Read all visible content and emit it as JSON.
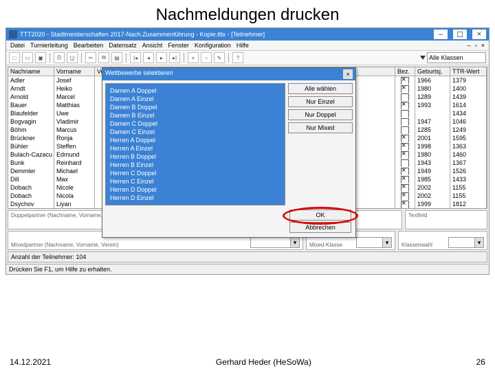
{
  "slide": {
    "title": "Nachmeldungen drucken",
    "date": "14.12.2021",
    "author": "Gerhard Heder (HeSoWa)",
    "page": "26"
  },
  "window": {
    "title": "TTT2020 - Stadtmeisterschaften 2017-Nach.Zusammenführung - Kopie.tttx - [Teilnehmer]"
  },
  "menu": {
    "m0": "Datei",
    "m1": "Turnierleitung",
    "m2": "Bearbeiten",
    "m3": "Datensatz",
    "m4": "Ansicht",
    "m5": "Fenster",
    "m6": "Konfiguration",
    "m7": "Hilfe"
  },
  "toolbar": {
    "klassen": "Alle Klassen"
  },
  "columns": {
    "c1": "Nachname",
    "c2": "Vorname",
    "c3": "Verein",
    "c4": "Bez.",
    "c5": "Geburtsj.",
    "c6": "TTR-Wert"
  },
  "rows": [
    {
      "n": "Adler",
      "v": "Josef",
      "b": true,
      "g": "1966",
      "t": "1379"
    },
    {
      "n": "Arndt",
      "v": "Heiko",
      "b": true,
      "g": "1980",
      "t": "1400"
    },
    {
      "n": "Arnold",
      "v": "Marcel",
      "b": false,
      "g": "1289",
      "t": "1439"
    },
    {
      "n": "Bauer",
      "v": "Matthias",
      "b": true,
      "g": "1993",
      "t": "1614"
    },
    {
      "n": "Blaufelder",
      "v": "Uwe",
      "b": false,
      "g": "",
      "t": "1434"
    },
    {
      "n": "Bogvagin",
      "v": "Vladimir",
      "b": false,
      "g": "1947",
      "t": "1046"
    },
    {
      "n": "Böhm",
      "v": "Marcus",
      "b": false,
      "g": "1285",
      "t": "1249"
    },
    {
      "n": "Brückner",
      "v": "Ronja",
      "b": true,
      "g": "2001",
      "t": "1595"
    },
    {
      "n": "Bühler",
      "v": "Steffen",
      "b": true,
      "g": "1998",
      "t": "1363"
    },
    {
      "n": "Bulach-Cazacu",
      "v": "Edmund",
      "b": true,
      "g": "1980",
      "t": "1460"
    },
    {
      "n": "Bunk",
      "v": "Reinhard",
      "b": false,
      "g": "1943",
      "t": "1367"
    },
    {
      "n": "Demmler",
      "v": "Michael",
      "b": true,
      "g": "1949",
      "t": "1526"
    },
    {
      "n": "Dill",
      "v": "Max",
      "b": true,
      "g": "1985",
      "t": "1433"
    },
    {
      "n": "Dobach",
      "v": "Nicole",
      "b": true,
      "g": "2002",
      "t": "1155"
    },
    {
      "n": "Dobach",
      "v": "Nicola",
      "b": true,
      "g": "2002",
      "t": "1155"
    },
    {
      "n": "Dsychov",
      "v": "Liyan",
      "b": true,
      "g": "1999",
      "t": "1812"
    }
  ],
  "dialog": {
    "title": "Wettbewerbe selektieren",
    "items": [
      "Damen A Doppel",
      "Damen A Einzel",
      "Damen B Doppel",
      "Damen B Einzel",
      "Damen C Doppel",
      "Damen C Einzel",
      "Herren A Doppel",
      "Herren A Einzel",
      "Herren B Doppel",
      "Herren B Einzel",
      "Herren C Doppel",
      "Herren C Einzel",
      "Herren D Doppel",
      "Herren D Einzel"
    ],
    "btn_all": "Alle wählen",
    "btn_einzel": "Nur Einzel",
    "btn_doppel": "Nur Doppel",
    "btn_mixed": "Nur Mixed",
    "ok": "OK",
    "cancel": "Abbrechen"
  },
  "lower": {
    "doppel": "Doppelpartner (Nachname, Vorname, Verein)",
    "mixed": "Mixedpartner (Nachname, Vorname, Verein)",
    "mixedklasse": "Mixed-Klasse",
    "klassenwahl": "Klassenwahl",
    "textfeld": "Textfeld",
    "count": "Anzahl der Teilnehmer: 104"
  },
  "status": "Drücken Sie F1, um Hilfe zu erhalten."
}
